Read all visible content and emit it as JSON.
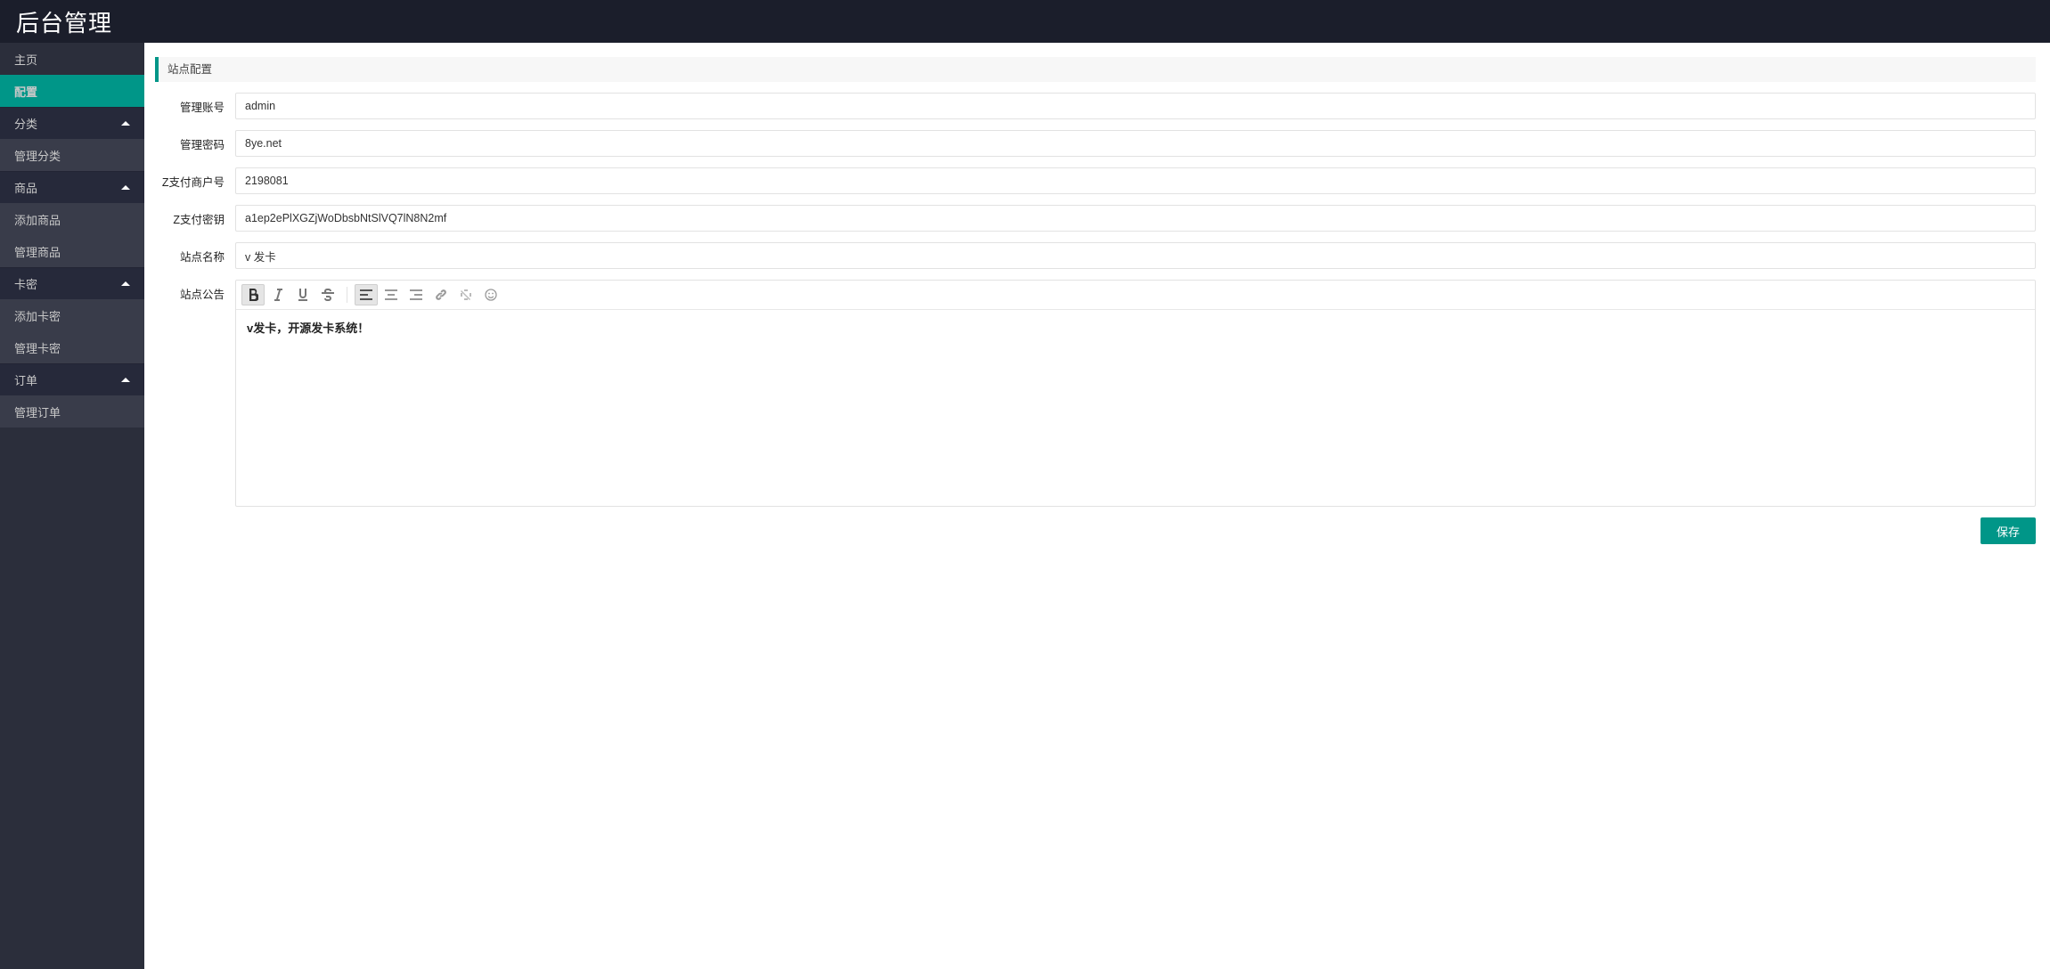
{
  "header": {
    "title": "后台管理"
  },
  "sidebar": {
    "home": "主页",
    "config": "配置",
    "groups": [
      {
        "label": "分类",
        "items": [
          "管理分类"
        ]
      },
      {
        "label": "商品",
        "items": [
          "添加商品",
          "管理商品"
        ]
      },
      {
        "label": "卡密",
        "items": [
          "添加卡密",
          "管理卡密"
        ]
      },
      {
        "label": "订单",
        "items": [
          "管理订单"
        ]
      }
    ]
  },
  "panel": {
    "title": "站点配置"
  },
  "form": {
    "admin_user": {
      "label": "管理账号",
      "value": "admin"
    },
    "admin_pass": {
      "label": "管理密码",
      "value": "8ye.net"
    },
    "zpay_mid": {
      "label": "Z支付商户号",
      "value": "2198081"
    },
    "zpay_key": {
      "label": "Z支付密钥",
      "value": "a1ep2ePlXGZjWoDbsbNtSlVQ7lN8N2mf"
    },
    "site_name": {
      "label": "站点名称",
      "value": "v 发卡"
    },
    "site_notice": {
      "label": "站点公告",
      "html": "v发卡，开源发卡系统！"
    }
  },
  "buttons": {
    "save": "保存"
  }
}
